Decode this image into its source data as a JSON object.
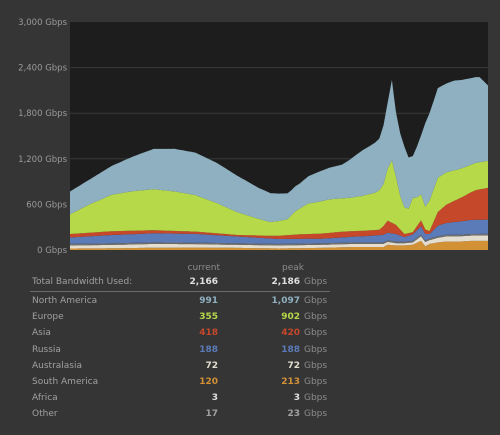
{
  "chart_data": {
    "type": "area",
    "stacked": true,
    "yticks": [
      "3,000 Gbps",
      "2,400 Gbps",
      "1,800 Gbps",
      "1,200 Gbps",
      "600 Gbps",
      "0 Gbps"
    ],
    "ylim": [
      0,
      3000
    ],
    "xlim": [
      0,
      100
    ],
    "grid": true,
    "background": "#1d1d1d",
    "gridColor": "#3a3a3a",
    "series": [
      {
        "key": "south_america",
        "color": "#d39136",
        "points": [
          [
            0,
            20
          ],
          [
            10,
            22
          ],
          [
            20,
            30
          ],
          [
            30,
            32
          ],
          [
            40,
            28
          ],
          [
            50,
            20
          ],
          [
            60,
            28
          ],
          [
            68,
            40
          ],
          [
            75,
            40
          ],
          [
            76,
            70
          ],
          [
            78,
            60
          ],
          [
            80,
            60
          ],
          [
            82,
            70
          ],
          [
            84,
            120
          ],
          [
            85,
            50
          ],
          [
            86,
            80
          ],
          [
            88,
            100
          ],
          [
            90,
            110
          ],
          [
            93,
            110
          ],
          [
            96,
            120
          ],
          [
            100,
            120
          ]
        ]
      },
      {
        "key": "australasia",
        "color": "#e3ded0",
        "points": [
          [
            0,
            40
          ],
          [
            20,
            50
          ],
          [
            40,
            40
          ],
          [
            60,
            40
          ],
          [
            75,
            40
          ],
          [
            78,
            30
          ],
          [
            82,
            30
          ],
          [
            84,
            60
          ],
          [
            86,
            50
          ],
          [
            88,
            60
          ],
          [
            90,
            70
          ],
          [
            95,
            70
          ],
          [
            100,
            72
          ]
        ]
      },
      {
        "key": "africa",
        "color": "#8a8a8a",
        "points": [
          [
            0,
            3
          ],
          [
            100,
            3
          ]
        ]
      },
      {
        "key": "other",
        "color": "#707070",
        "points": [
          [
            0,
            17
          ],
          [
            100,
            17
          ]
        ]
      },
      {
        "key": "russia",
        "color": "#5b7ab8",
        "points": [
          [
            0,
            85
          ],
          [
            10,
            110
          ],
          [
            20,
            120
          ],
          [
            30,
            115
          ],
          [
            40,
            90
          ],
          [
            50,
            65
          ],
          [
            60,
            60
          ],
          [
            70,
            80
          ],
          [
            75,
            100
          ],
          [
            78,
            100
          ],
          [
            80,
            60
          ],
          [
            84,
            110
          ],
          [
            86,
            60
          ],
          [
            88,
            140
          ],
          [
            92,
            170
          ],
          [
            96,
            185
          ],
          [
            100,
            188
          ]
        ]
      },
      {
        "key": "asia",
        "color": "#c5482a",
        "points": [
          [
            0,
            45
          ],
          [
            10,
            50
          ],
          [
            20,
            40
          ],
          [
            30,
            30
          ],
          [
            40,
            20
          ],
          [
            48,
            35
          ],
          [
            55,
            60
          ],
          [
            65,
            75
          ],
          [
            74,
            70
          ],
          [
            76,
            160
          ],
          [
            78,
            120
          ],
          [
            80,
            40
          ],
          [
            82,
            30
          ],
          [
            84,
            80
          ],
          [
            86,
            40
          ],
          [
            88,
            180
          ],
          [
            90,
            240
          ],
          [
            94,
            320
          ],
          [
            97,
            390
          ],
          [
            100,
            418
          ]
        ]
      },
      {
        "key": "europe",
        "color": "#b6d94a",
        "points": [
          [
            0,
            260
          ],
          [
            5,
            380
          ],
          [
            10,
            480
          ],
          [
            15,
            520
          ],
          [
            20,
            540
          ],
          [
            25,
            520
          ],
          [
            30,
            480
          ],
          [
            35,
            400
          ],
          [
            40,
            300
          ],
          [
            45,
            220
          ],
          [
            48,
            180
          ],
          [
            52,
            210
          ],
          [
            54,
            310
          ],
          [
            57,
            400
          ],
          [
            62,
            440
          ],
          [
            67,
            440
          ],
          [
            70,
            460
          ],
          [
            73,
            490
          ],
          [
            75,
            550
          ],
          [
            77,
            820
          ],
          [
            79,
            440
          ],
          [
            80,
            350
          ],
          [
            81,
            320
          ],
          [
            82,
            450
          ],
          [
            83,
            380
          ],
          [
            84,
            340
          ],
          [
            85,
            300
          ],
          [
            86,
            400
          ],
          [
            88,
            450
          ],
          [
            92,
            400
          ],
          [
            96,
            360
          ],
          [
            100,
            355
          ]
        ]
      },
      {
        "key": "north_america",
        "color": "#8fb0c0",
        "points": [
          [
            0,
            300
          ],
          [
            5,
            330
          ],
          [
            10,
            380
          ],
          [
            20,
            530
          ],
          [
            25,
            560
          ],
          [
            30,
            560
          ],
          [
            35,
            530
          ],
          [
            40,
            480
          ],
          [
            45,
            410
          ],
          [
            50,
            360
          ],
          [
            53,
            330
          ],
          [
            55,
            330
          ],
          [
            57,
            360
          ],
          [
            60,
            400
          ],
          [
            65,
            440
          ],
          [
            70,
            600
          ],
          [
            74,
            680
          ],
          [
            76,
            870
          ],
          [
            77,
            1060
          ],
          [
            78,
            850
          ],
          [
            80,
            800
          ],
          [
            82,
            550
          ],
          [
            84,
            780
          ],
          [
            85,
            1100
          ],
          [
            86,
            1150
          ],
          [
            88,
            1180
          ],
          [
            90,
            1170
          ],
          [
            92,
            1180
          ],
          [
            95,
            1150
          ],
          [
            98,
            1120
          ],
          [
            100,
            991
          ]
        ]
      }
    ]
  },
  "legend": {
    "header": {
      "current": "current",
      "peak": "peak"
    },
    "total": {
      "label": "Total Bandwidth Used:",
      "current": "2,166",
      "peak": "2,186",
      "unit": "Gbps"
    },
    "rows": [
      {
        "name": "North America",
        "current": "991",
        "peak": "1,097",
        "unit": "Gbps",
        "color": "#8fb0c0"
      },
      {
        "name": "Europe",
        "current": "355",
        "peak": "902",
        "unit": "Gbps",
        "color": "#b6d94a"
      },
      {
        "name": "Asia",
        "current": "418",
        "peak": "420",
        "unit": "Gbps",
        "color": "#c5482a"
      },
      {
        "name": "Russia",
        "current": "188",
        "peak": "188",
        "unit": "Gbps",
        "color": "#5b7ab8"
      },
      {
        "name": "Australasia",
        "current": "72",
        "peak": "72",
        "unit": "Gbps",
        "color": "#e3ded0"
      },
      {
        "name": "South America",
        "current": "120",
        "peak": "213",
        "unit": "Gbps",
        "color": "#d39136"
      },
      {
        "name": "Africa",
        "current": "3",
        "peak": "3",
        "unit": "Gbps",
        "color": "#e0e0e0"
      },
      {
        "name": "Other",
        "current": "17",
        "peak": "23",
        "unit": "Gbps",
        "color": "#a0a0a0"
      }
    ]
  }
}
